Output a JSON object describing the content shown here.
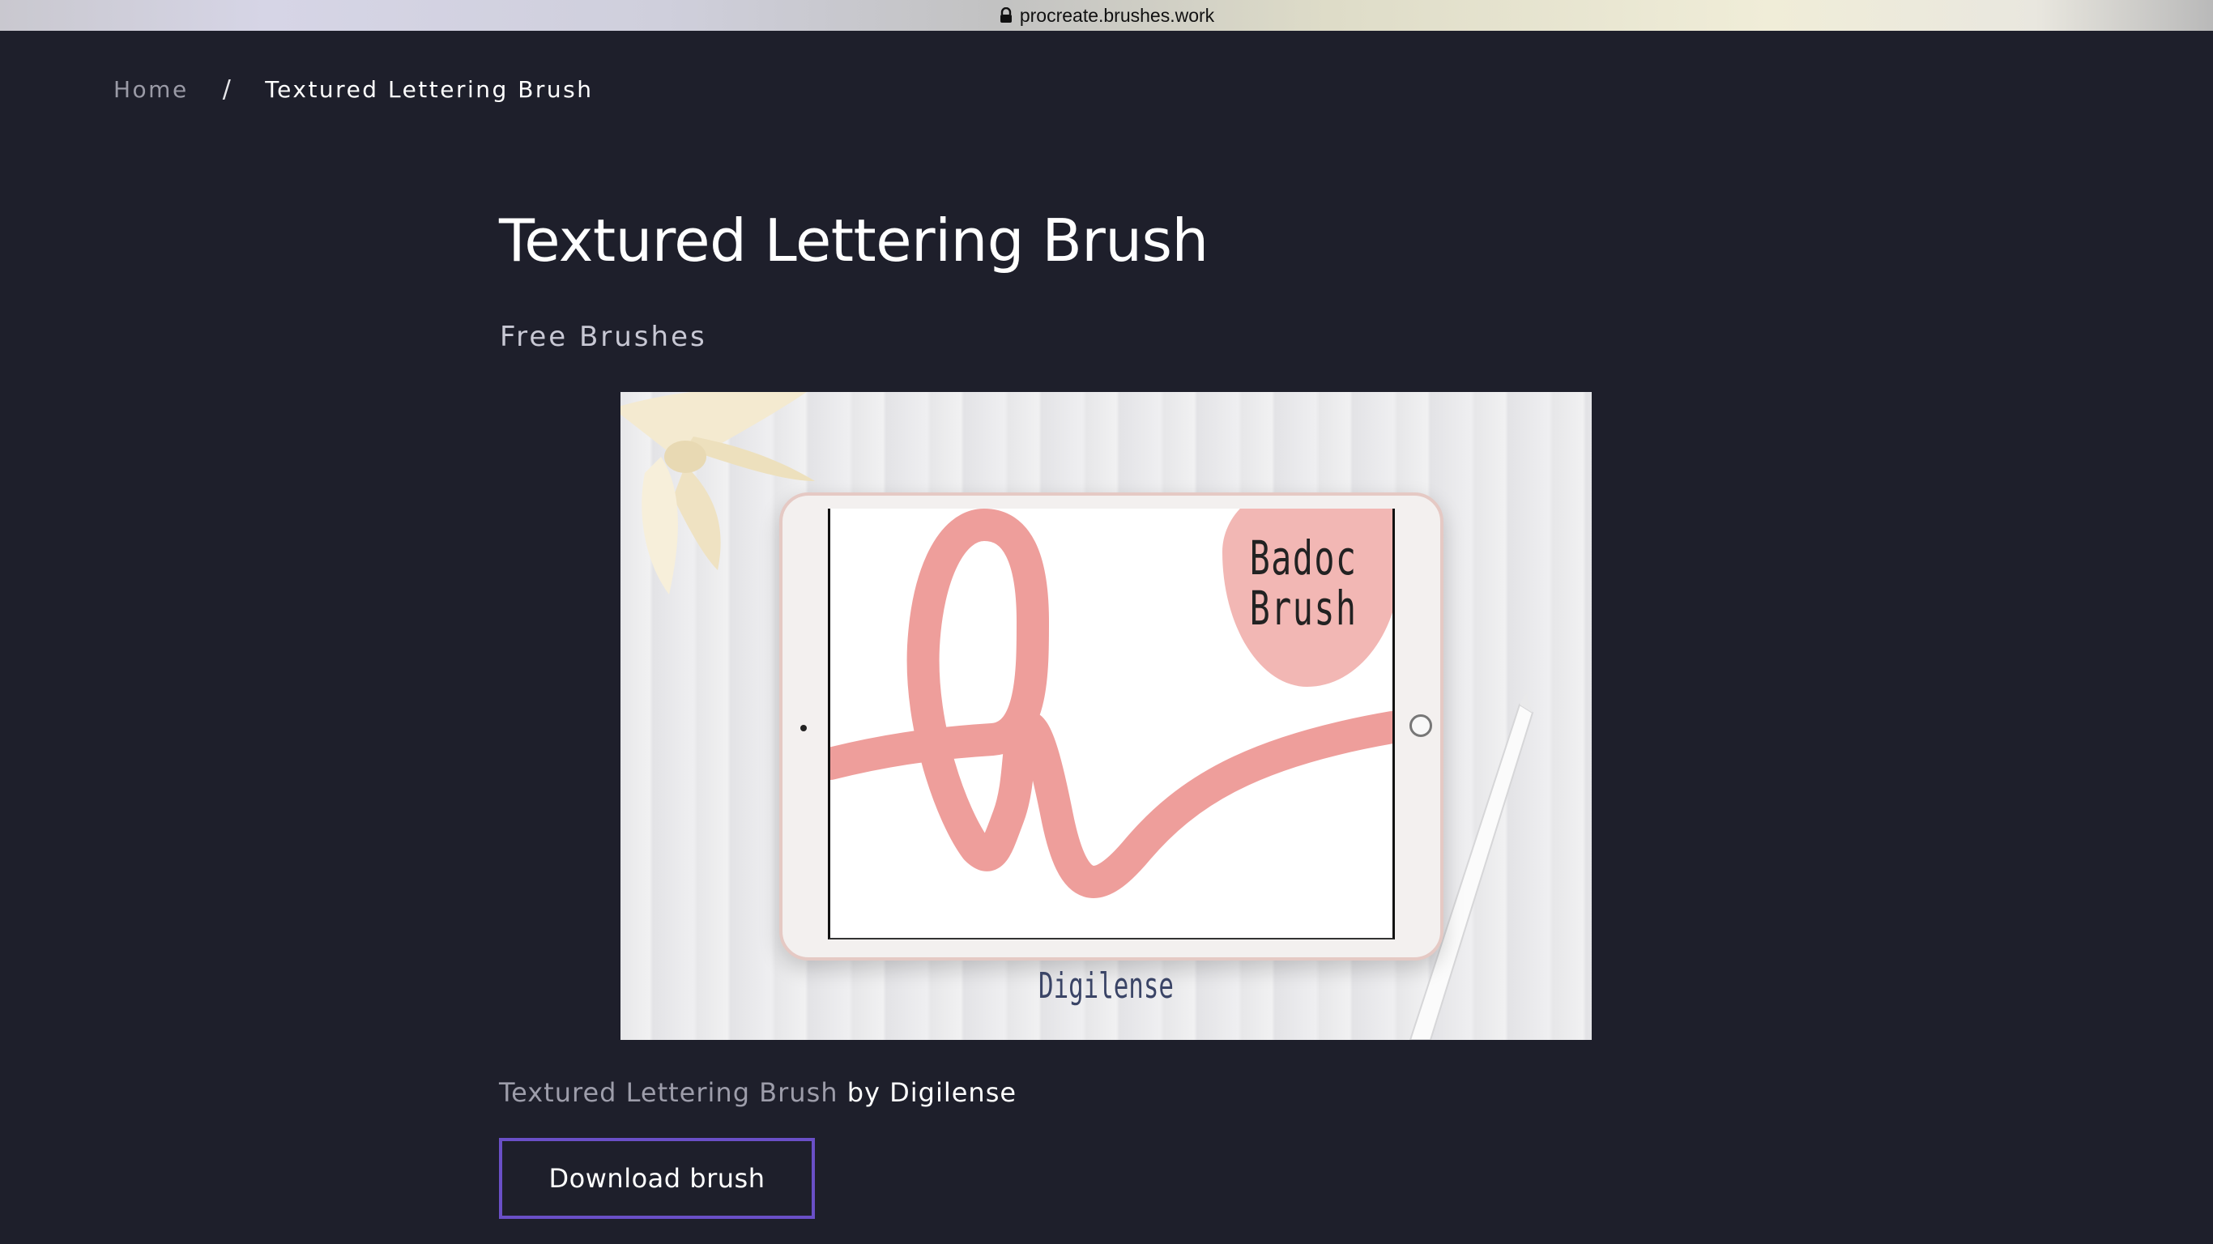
{
  "browser": {
    "url": "procreate.brushes.work",
    "lock_icon": "lock-icon"
  },
  "breadcrumb": {
    "home": "Home",
    "separator": "/",
    "current": "Textured Lettering Brush"
  },
  "page": {
    "title": "Textured Lettering Brush",
    "category": "Free Brushes"
  },
  "hero_image": {
    "screen_text_line1": "Badoc",
    "screen_text_line2": "Brush",
    "caption": "Digilense",
    "colors": {
      "stroke": "#ee9e9b",
      "blob": "#f2b7b4",
      "caption": "#3a4466"
    }
  },
  "credit": {
    "link_text": "Textured Lettering Brush",
    "by_text": "by Digilense"
  },
  "actions": {
    "download_label": "Download brush",
    "accent": "#6a4fc7"
  },
  "theme": {
    "background": "#1e1f2b"
  }
}
